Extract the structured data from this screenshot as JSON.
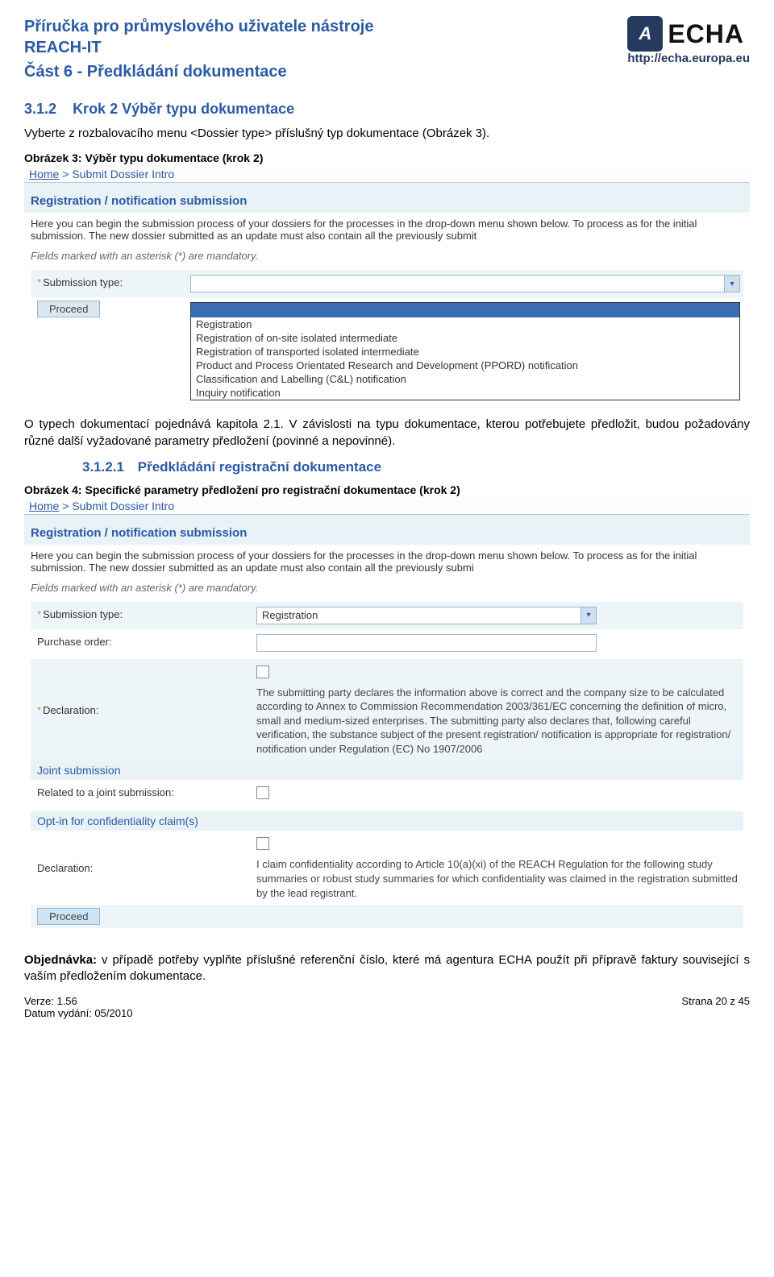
{
  "header": {
    "title_line1": "Příručka pro průmyslového uživatele nástroje",
    "title_line2": "REACH-IT",
    "subtitle": "Část 6 - Předkládání dokumentace",
    "logo_text": "ECHA",
    "logo_badge": "A",
    "logo_url": "http://echa.europa.eu"
  },
  "section": {
    "num": "3.1.2",
    "title": "Krok 2 Výběr typu dokumentace",
    "intro": "Vyberte z rozbalovacího menu <Dossier type> příslušný typ dokumentace (Obrázek 3).",
    "fig3_label": "Obrázek 3:    Výběr typu dokumentace (krok 2)"
  },
  "screenshot1": {
    "breadcrumb_home": "Home",
    "breadcrumb_rest": " > Submit Dossier Intro",
    "heading": "Registration / notification submission",
    "desc": "Here you can begin the submission process of your dossiers for the processes in the drop-down menu shown below. To process as for the initial submission. The new dossier submitted as an update must also contain all the previously submit",
    "mandatory_note": "Fields marked with an asterisk (*) are mandatory.",
    "label_subtype": "Submission type:",
    "proceed": "Proceed",
    "options": [
      "Registration",
      "Registration of on-site isolated intermediate",
      "Registration of transported isolated intermediate",
      "Product and Process Orientated Research and Development (PPORD) notification",
      "Classification and Labelling (C&L) notification",
      "Inquiry notification"
    ]
  },
  "mid_text": {
    "p1": "O typech dokumentací pojednává kapitola 2.1. V závislosti na typu dokumentace, kterou potřebujete předložit, budou požadovány různé další vyžadované parametry předložení (povinné a nepovinné).",
    "subsec_num": "3.1.2.1",
    "subsec_title": "Předkládání registrační dokumentace",
    "fig4_label": "Obrázek 4:    Specifické parametry předložení pro registrační dokumentace (krok 2)"
  },
  "screenshot2": {
    "breadcrumb_home": "Home",
    "breadcrumb_rest": " > Submit Dossier Intro",
    "heading": "Registration / notification submission",
    "desc": "Here you can begin the submission process of your dossiers for the processes in the drop-down menu shown below. To process as for the initial submission. The new dossier submitted as an update must also contain all the previously submi",
    "mandatory_note": "Fields marked with an asterisk (*) are mandatory.",
    "label_subtype": "Submission type:",
    "subtype_value": "Registration",
    "label_purchase": "Purchase order:",
    "label_decl1": "Declaration:",
    "decl1_text": "The submitting party declares the information above is correct and the company size to be calculated according to Annex to Commission Recommendation 2003/361/EC concerning the definition of micro, small and medium-sized enterprises. The submitting party also declares that, following careful verification, the substance subject of the present registration/ notification is appropriate for registration/ notification under Regulation (EC) No 1907/2006",
    "band_joint": "Joint submission",
    "label_related": "Related to a joint submission:",
    "band_optin": "Opt-in for confidentiality claim(s)",
    "label_decl2": "Declaration:",
    "decl2_text": "I claim confidentiality according to Article 10(a)(xi) of the REACH Regulation for the following study summaries or robust study summaries for which confidentiality was claimed in the registration submitted by the lead registrant.",
    "proceed": "Proceed"
  },
  "bottom_text": "Objednávka: v případě potřeby vyplňte příslušné referenční číslo, které má agentura ECHA použít při přípravě faktury související s vaším předložením dokumentace.",
  "footer": {
    "version": "Verze: 1.56",
    "date": "Datum vydání: 05/2010",
    "page": "Strana 20 z 45"
  }
}
